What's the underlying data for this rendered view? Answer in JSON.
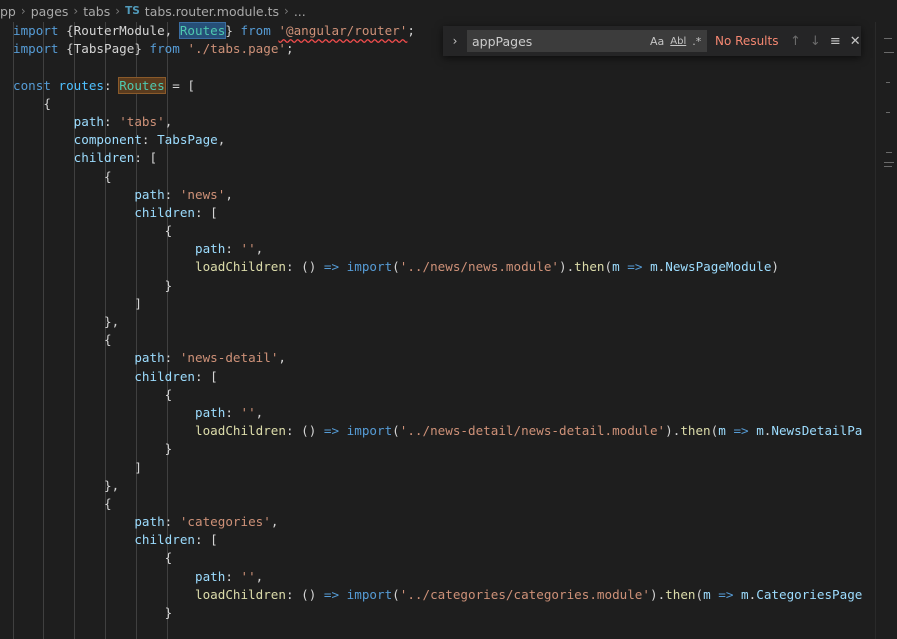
{
  "breadcrumb": {
    "segments": [
      "pp",
      "pages",
      "tabs"
    ],
    "file_icon": "TS",
    "file_name": "tabs.router.module.ts",
    "more": "..."
  },
  "find": {
    "query": "appPages",
    "status": "No Results",
    "toggle_icon": "chevron-right-icon",
    "match_case_label": "Aa",
    "whole_word_label": "Abl",
    "regex_label": ".*",
    "colors": {
      "status": "#f48771",
      "background": "#252526"
    }
  },
  "code": {
    "lines": [
      [
        [
          "kw",
          "import"
        ],
        [
          "pl",
          " {RouterModule, "
        ],
        [
          "hl",
          "Routes"
        ],
        [
          "pl",
          "} "
        ],
        [
          "kw",
          "from"
        ],
        [
          "pl",
          " "
        ],
        [
          "strsq",
          "'@angular/router'"
        ],
        [
          "pl",
          ";"
        ]
      ],
      [
        [
          "kw",
          "import"
        ],
        [
          "pl",
          " {TabsPage} "
        ],
        [
          "kw",
          "from"
        ],
        [
          "pl",
          " "
        ],
        [
          "str",
          "'./tabs.page'"
        ],
        [
          "pl",
          ";"
        ]
      ],
      [],
      [
        [
          "kw",
          "const"
        ],
        [
          "pl",
          " "
        ],
        [
          "var",
          "routes"
        ],
        [
          "pl",
          ": "
        ],
        [
          "hl2",
          "Routes"
        ],
        [
          "pl",
          " = ["
        ]
      ],
      [
        [
          "pl",
          "    {"
        ]
      ],
      [
        [
          "pl",
          "        "
        ],
        [
          "prop",
          "path"
        ],
        [
          "pl",
          ": "
        ],
        [
          "str",
          "'tabs'"
        ],
        [
          "pl",
          ","
        ]
      ],
      [
        [
          "pl",
          "        "
        ],
        [
          "prop",
          "component"
        ],
        [
          "pl",
          ": "
        ],
        [
          "prop",
          "TabsPage"
        ],
        [
          "pl",
          ","
        ]
      ],
      [
        [
          "pl",
          "        "
        ],
        [
          "prop",
          "children"
        ],
        [
          "pl",
          ": ["
        ]
      ],
      [
        [
          "pl",
          "            {"
        ]
      ],
      [
        [
          "pl",
          "                "
        ],
        [
          "prop",
          "path"
        ],
        [
          "pl",
          ": "
        ],
        [
          "str",
          "'news'"
        ],
        [
          "pl",
          ","
        ]
      ],
      [
        [
          "pl",
          "                "
        ],
        [
          "prop",
          "children"
        ],
        [
          "pl",
          ": ["
        ]
      ],
      [
        [
          "pl",
          "                    {"
        ]
      ],
      [
        [
          "pl",
          "                        "
        ],
        [
          "prop",
          "path"
        ],
        [
          "pl",
          ": "
        ],
        [
          "str",
          "''"
        ],
        [
          "pl",
          ","
        ]
      ],
      [
        [
          "pl",
          "                        "
        ],
        [
          "fn",
          "loadChildren"
        ],
        [
          "pl",
          ": () "
        ],
        [
          "kw",
          "=>"
        ],
        [
          "pl",
          " "
        ],
        [
          "kw",
          "import"
        ],
        [
          "pl",
          "("
        ],
        [
          "str",
          "'../news/news.module'"
        ],
        [
          "pl",
          ")."
        ],
        [
          "fn",
          "then"
        ],
        [
          "pl",
          "("
        ],
        [
          "prop",
          "m"
        ],
        [
          "pl",
          " "
        ],
        [
          "kw",
          "=>"
        ],
        [
          "pl",
          " "
        ],
        [
          "prop",
          "m"
        ],
        [
          "pl",
          "."
        ],
        [
          "prop",
          "NewsPageModule"
        ],
        [
          "pl",
          ")"
        ]
      ],
      [
        [
          "pl",
          "                    }"
        ]
      ],
      [
        [
          "pl",
          "                ]"
        ]
      ],
      [
        [
          "pl",
          "            },"
        ]
      ],
      [
        [
          "pl",
          "            {"
        ]
      ],
      [
        [
          "pl",
          "                "
        ],
        [
          "prop",
          "path"
        ],
        [
          "pl",
          ": "
        ],
        [
          "str",
          "'news-detail'"
        ],
        [
          "pl",
          ","
        ]
      ],
      [
        [
          "pl",
          "                "
        ],
        [
          "prop",
          "children"
        ],
        [
          "pl",
          ": ["
        ]
      ],
      [
        [
          "pl",
          "                    {"
        ]
      ],
      [
        [
          "pl",
          "                        "
        ],
        [
          "prop",
          "path"
        ],
        [
          "pl",
          ": "
        ],
        [
          "str",
          "''"
        ],
        [
          "pl",
          ","
        ]
      ],
      [
        [
          "pl",
          "                        "
        ],
        [
          "fn",
          "loadChildren"
        ],
        [
          "pl",
          ": () "
        ],
        [
          "kw",
          "=>"
        ],
        [
          "pl",
          " "
        ],
        [
          "kw",
          "import"
        ],
        [
          "pl",
          "("
        ],
        [
          "str",
          "'../news-detail/news-detail.module'"
        ],
        [
          "pl",
          ")."
        ],
        [
          "fn",
          "then"
        ],
        [
          "pl",
          "("
        ],
        [
          "prop",
          "m"
        ],
        [
          "pl",
          " "
        ],
        [
          "kw",
          "=>"
        ],
        [
          "pl",
          " "
        ],
        [
          "prop",
          "m"
        ],
        [
          "pl",
          "."
        ],
        [
          "prop",
          "NewsDetailPa"
        ]
      ],
      [
        [
          "pl",
          "                    }"
        ]
      ],
      [
        [
          "pl",
          "                ]"
        ]
      ],
      [
        [
          "pl",
          "            },"
        ]
      ],
      [
        [
          "pl",
          "            {"
        ]
      ],
      [
        [
          "pl",
          "                "
        ],
        [
          "prop",
          "path"
        ],
        [
          "pl",
          ": "
        ],
        [
          "str",
          "'categories'"
        ],
        [
          "pl",
          ","
        ]
      ],
      [
        [
          "pl",
          "                "
        ],
        [
          "prop",
          "children"
        ],
        [
          "pl",
          ": ["
        ]
      ],
      [
        [
          "pl",
          "                    {"
        ]
      ],
      [
        [
          "pl",
          "                        "
        ],
        [
          "prop",
          "path"
        ],
        [
          "pl",
          ": "
        ],
        [
          "str",
          "''"
        ],
        [
          "pl",
          ","
        ]
      ],
      [
        [
          "pl",
          "                        "
        ],
        [
          "fn",
          "loadChildren"
        ],
        [
          "pl",
          ": () "
        ],
        [
          "kw",
          "=>"
        ],
        [
          "pl",
          " "
        ],
        [
          "kw",
          "import"
        ],
        [
          "pl",
          "("
        ],
        [
          "str",
          "'../categories/categories.module'"
        ],
        [
          "pl",
          ")."
        ],
        [
          "fn",
          "then"
        ],
        [
          "pl",
          "("
        ],
        [
          "prop",
          "m"
        ],
        [
          "pl",
          " "
        ],
        [
          "kw",
          "=>"
        ],
        [
          "pl",
          " "
        ],
        [
          "prop",
          "m"
        ],
        [
          "pl",
          "."
        ],
        [
          "prop",
          "CategoriesPage"
        ]
      ],
      [
        [
          "pl",
          "                    }"
        ]
      ]
    ]
  }
}
